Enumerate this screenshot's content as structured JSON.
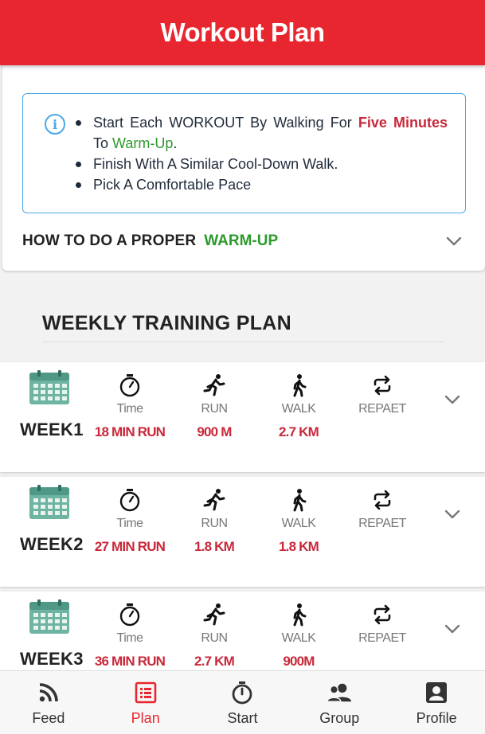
{
  "header": {
    "title": "Workout Plan"
  },
  "info": {
    "line1_start": "Start Each WORKOUT By Walking For ",
    "line1_red": "Five Minutes",
    "line1_mid": " To ",
    "line1_green": "Warm-Up",
    "line1_end": ".",
    "line2": "Finish With A Similar Cool-Down Walk.",
    "line3": "Pick A Comfortable Pace"
  },
  "warmup": {
    "label": "HOW TO DO A PROPER",
    "highlight": "WARM-UP"
  },
  "plan": {
    "title": "WEEKLY TRAINING PLAN",
    "captions": {
      "time": "Time",
      "run": "RUN",
      "walk": "WALK",
      "repeat": "REPAET"
    },
    "weeks": [
      {
        "name": "WEEK1",
        "time": "18 MIN RUN",
        "run": "900 M",
        "walk": "2.7 KM",
        "repeat": ""
      },
      {
        "name": "WEEK2",
        "time": "27 MIN RUN",
        "run": "1.8 KM",
        "walk": "1.8 KM",
        "repeat": ""
      },
      {
        "name": "WEEK3",
        "time": "36 MIN RUN",
        "run": "2.7 KM",
        "walk": "900M",
        "repeat": ""
      }
    ]
  },
  "tabs": [
    {
      "label": "Feed",
      "icon": "rss-icon"
    },
    {
      "label": "Plan",
      "icon": "list-icon",
      "active": true
    },
    {
      "label": "Start",
      "icon": "stopwatch-icon"
    },
    {
      "label": "Group",
      "icon": "group-icon"
    },
    {
      "label": "Profile",
      "icon": "profile-icon"
    }
  ],
  "colors": {
    "brand": "#e8262f",
    "accent_red": "#c8283a",
    "accent_green": "#2c9a2c",
    "info_blue": "#4aa8e6"
  }
}
